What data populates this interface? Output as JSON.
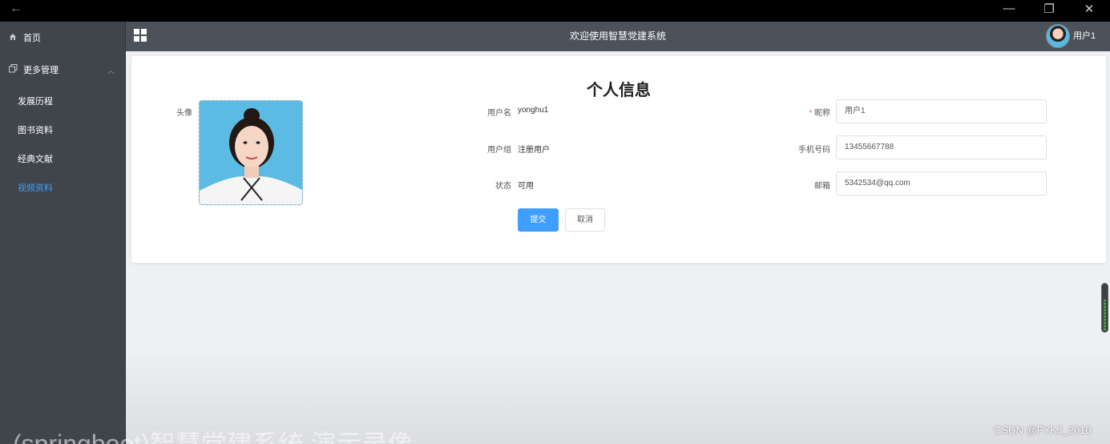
{
  "window": {
    "back_glyph": "←",
    "minimize_glyph": "—",
    "restore_glyph": "❐",
    "close_glyph": "✕"
  },
  "sidebar": {
    "home": {
      "label": "首页",
      "icon": "home-icon"
    },
    "more": {
      "label": "更多管理",
      "icon": "copy-icon",
      "caret": "︿"
    },
    "items": [
      {
        "label": "发展历程"
      },
      {
        "label": "图书资料"
      },
      {
        "label": "经典文献"
      },
      {
        "label": "视频资料",
        "active": true
      }
    ]
  },
  "header": {
    "title": "欢迎使用智慧党建系统",
    "username": "用户1"
  },
  "profile": {
    "heading": "个人信息",
    "avatar_label": "头像",
    "username_label": "用户名",
    "username_value": "yonghu1",
    "group_label": "用户组",
    "group_value": "注册用户",
    "status_label": "状态",
    "status_value": "可用",
    "required_mark": "*",
    "nickname_label": "昵称",
    "nickname_value": "用户1",
    "phone_label": "手机号码",
    "phone_value": "13455667788",
    "email_label": "邮箱",
    "email_value": "5342534@qq.com",
    "submit_label": "提交",
    "cancel_label": "取消"
  },
  "watermark": "CSDN @FYKJ_2010",
  "overlay_caption": "(springboot)智慧党建系统 演示录像",
  "colors": {
    "accent": "#409eff",
    "sidebar_bg": "#3f454b",
    "header_bg": "#4b5259",
    "required": "#f56c6c"
  }
}
